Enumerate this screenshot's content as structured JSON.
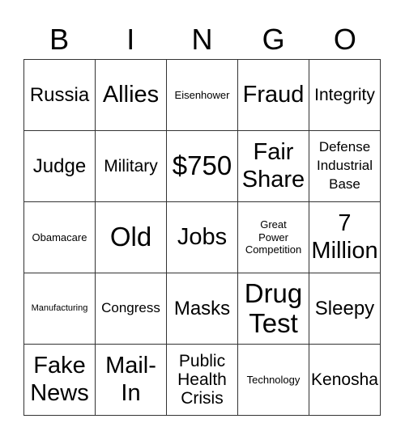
{
  "header": {
    "letters": [
      "B",
      "I",
      "N",
      "G",
      "O"
    ]
  },
  "card": {
    "rows": [
      [
        "Russia",
        "Allies",
        "Eisenhower",
        "Fraud",
        "Integrity"
      ],
      [
        "Judge",
        "Military",
        "$750",
        "Fair\nShare",
        "Defense\nIndustrial\nBase"
      ],
      [
        "Obamacare",
        "Old",
        "Jobs",
        "Great\nPower\nCompetition",
        "7\nMillion"
      ],
      [
        "Manufacturing",
        "Congress",
        "Masks",
        "Drug\nTest",
        "Sleepy"
      ],
      [
        "Fake\nNews",
        "Mail-\nIn",
        "Public\nHealth\nCrisis",
        "Technology",
        "Kenosha"
      ]
    ]
  }
}
